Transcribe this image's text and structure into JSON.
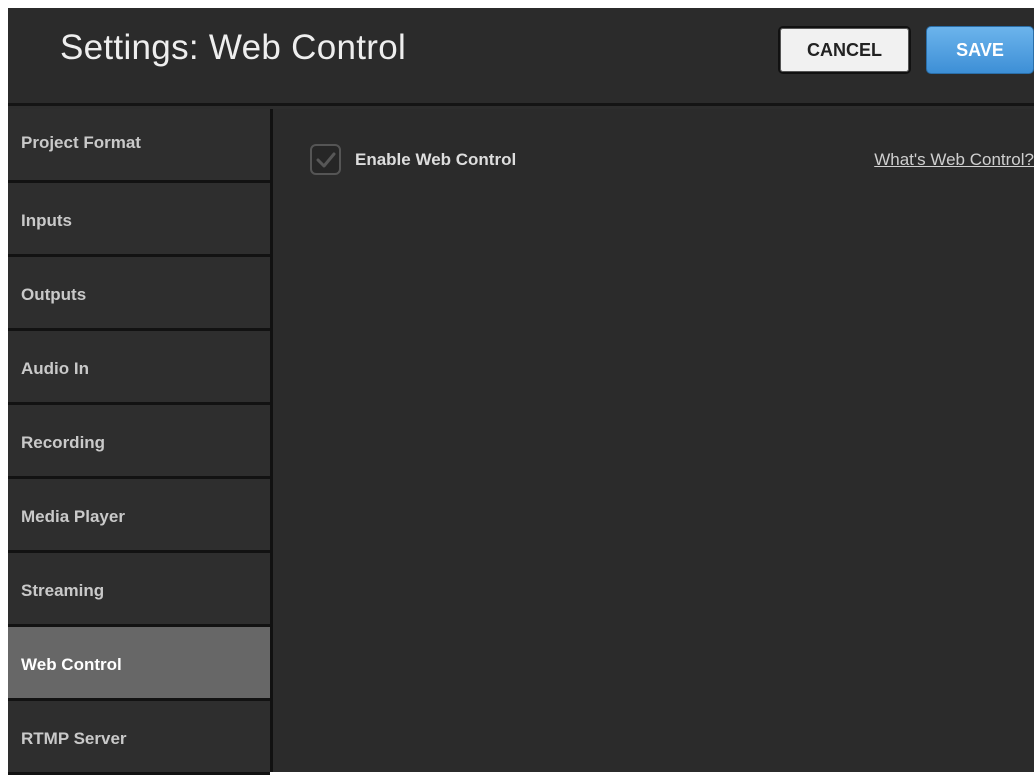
{
  "header": {
    "title": "Settings: Web Control",
    "cancel_label": "CANCEL",
    "save_label": "SAVE",
    "save_color": "#4a9de0"
  },
  "sidebar": {
    "items": [
      {
        "label": "Project Format",
        "active": false
      },
      {
        "label": "Inputs",
        "active": false
      },
      {
        "label": "Outputs",
        "active": false
      },
      {
        "label": "Audio In",
        "active": false
      },
      {
        "label": "Recording",
        "active": false
      },
      {
        "label": "Media Player",
        "active": false
      },
      {
        "label": "Streaming",
        "active": false
      },
      {
        "label": "Web Control",
        "active": true
      },
      {
        "label": "RTMP Server",
        "active": false
      }
    ]
  },
  "main": {
    "enable_checkbox": {
      "label": "Enable Web Control",
      "checked": true,
      "icon": "checkmark-icon"
    },
    "help_link": "What's Web Control?"
  }
}
